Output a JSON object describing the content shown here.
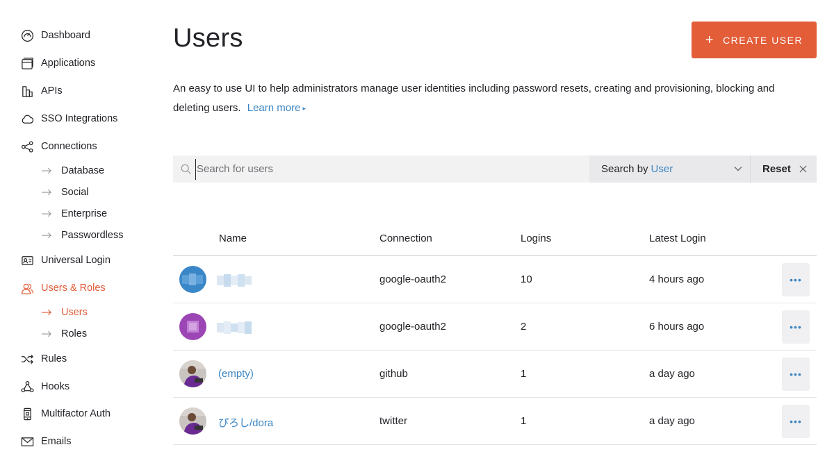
{
  "sidebar": {
    "items": [
      {
        "label": "Dashboard",
        "icon": "dashboard-icon"
      },
      {
        "label": "Applications",
        "icon": "applications-icon"
      },
      {
        "label": "APIs",
        "icon": "apis-icon"
      },
      {
        "label": "SSO Integrations",
        "icon": "cloud-icon"
      },
      {
        "label": "Connections",
        "icon": "connections-icon"
      },
      {
        "label": "Universal Login",
        "icon": "id-card-icon"
      },
      {
        "label": "Users & Roles",
        "icon": "users-icon"
      },
      {
        "label": "Rules",
        "icon": "shuffle-icon"
      },
      {
        "label": "Hooks",
        "icon": "hooks-icon"
      },
      {
        "label": "Multifactor Auth",
        "icon": "phone-icon"
      },
      {
        "label": "Emails",
        "icon": "mail-icon"
      }
    ],
    "connections_sub": [
      "Database",
      "Social",
      "Enterprise",
      "Passwordless"
    ],
    "users_roles_sub": [
      "Users",
      "Roles"
    ],
    "active_item": "Users & Roles",
    "active_sub": "Users"
  },
  "header": {
    "title": "Users",
    "create_button": "CREATE USER",
    "create_icon": "+"
  },
  "description": {
    "text": "An easy to use UI to help administrators manage user identities including password resets, creating and provisioning, blocking and deleting users.",
    "learn_more": "Learn more",
    "learn_more_icon": "▸"
  },
  "search": {
    "placeholder": "Search for users",
    "search_by_label": "Search by",
    "search_by_value": "User",
    "reset_label": "Reset"
  },
  "table": {
    "headers": {
      "name": "Name",
      "connection": "Connection",
      "logins": "Logins",
      "latest_login": "Latest Login"
    },
    "rows": [
      {
        "name": "",
        "connection": "google-oauth2",
        "logins": "10",
        "latest_login": "4 hours ago"
      },
      {
        "name": "",
        "connection": "google-oauth2",
        "logins": "2",
        "latest_login": "6 hours ago"
      },
      {
        "name": "(empty)",
        "connection": "github",
        "logins": "1",
        "latest_login": "a day ago"
      },
      {
        "name": "ぴろし/dora",
        "connection": "twitter",
        "logins": "1",
        "latest_login": "a day ago"
      }
    ],
    "more_icon": "•••"
  },
  "colors": {
    "accent": "#e25d38",
    "link": "#3c86c3",
    "avatar_blue": "#3a87c8",
    "avatar_purple": "#9c46b5"
  }
}
